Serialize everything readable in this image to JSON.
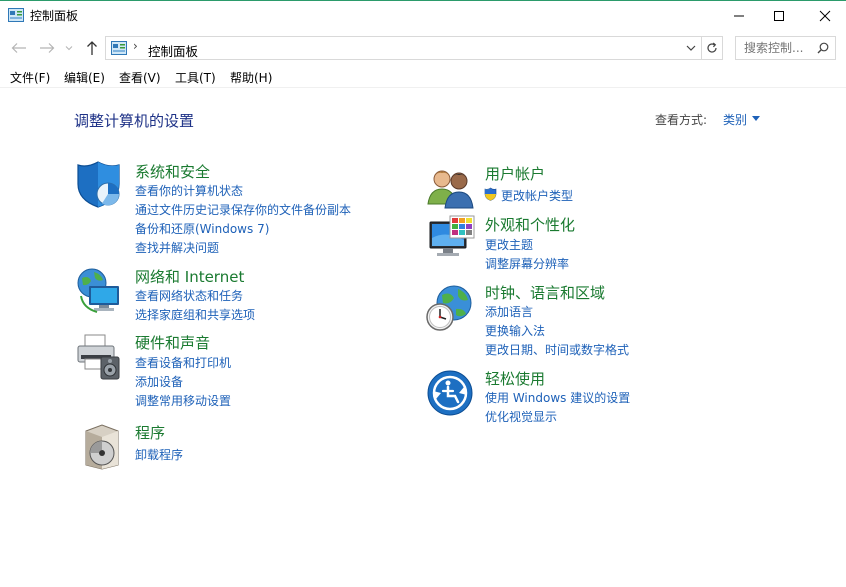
{
  "window": {
    "title": "控制面板"
  },
  "address": {
    "crumb": "控制面板",
    "separator": "›"
  },
  "search": {
    "placeholder": "搜索控制..."
  },
  "menu": [
    "文件(F)",
    "编辑(E)",
    "查看(V)",
    "工具(T)",
    "帮助(H)"
  ],
  "content": {
    "title": "调整计算机的设置",
    "view_by_label": "查看方式:",
    "view_by_value": "类别"
  },
  "categories": {
    "system_security": {
      "title": "系统和安全",
      "links": [
        "查看你的计算机状态",
        "通过文件历史记录保存你的文件备份副本",
        "备份和还原(Windows 7)",
        "查找并解决问题"
      ]
    },
    "network": {
      "title": "网络和 Internet",
      "links": [
        "查看网络状态和任务",
        "选择家庭组和共享选项"
      ]
    },
    "hardware": {
      "title": "硬件和声音",
      "links": [
        "查看设备和打印机",
        "添加设备",
        "调整常用移动设置"
      ]
    },
    "programs": {
      "title": "程序",
      "links": [
        "卸载程序"
      ]
    },
    "user_accounts": {
      "title": "用户帐户",
      "links": [
        "更改帐户类型"
      ]
    },
    "appearance": {
      "title": "外观和个性化",
      "links": [
        "更改主题",
        "调整屏幕分辨率"
      ]
    },
    "clock_region": {
      "title": "时钟、语言和区域",
      "links": [
        "添加语言",
        "更换输入法",
        "更改日期、时间或数字格式"
      ]
    },
    "ease_access": {
      "title": "轻松使用",
      "links": [
        "使用 Windows 建议的设置",
        "优化视觉显示"
      ]
    }
  },
  "colors": {
    "category_title": "#1a7a30",
    "link": "#1e61b8",
    "page_title": "#1e3287",
    "window_border": "#2b9b6b"
  }
}
